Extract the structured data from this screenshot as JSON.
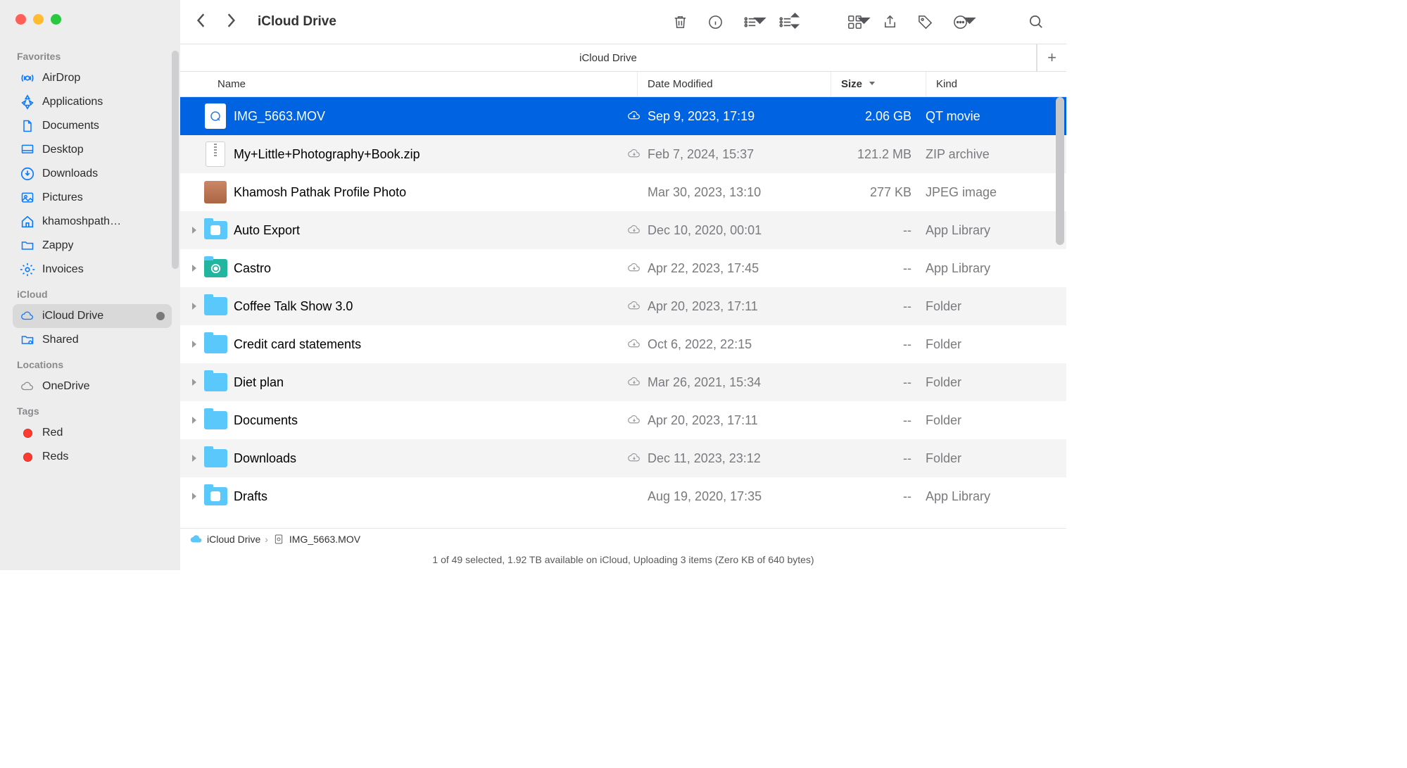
{
  "window": {
    "title": "iCloud Drive"
  },
  "sidebar": {
    "sections": [
      {
        "header": "Favorites",
        "items": [
          {
            "icon": "airdrop",
            "label": "AirDrop"
          },
          {
            "icon": "app",
            "label": "Applications"
          },
          {
            "icon": "doc",
            "label": "Documents"
          },
          {
            "icon": "desktop",
            "label": "Desktop"
          },
          {
            "icon": "download",
            "label": "Downloads"
          },
          {
            "icon": "pictures",
            "label": "Pictures"
          },
          {
            "icon": "home",
            "label": "khamoshpath…"
          },
          {
            "icon": "folder",
            "label": "Zappy"
          },
          {
            "icon": "gear",
            "label": "Invoices"
          }
        ]
      },
      {
        "header": "iCloud",
        "items": [
          {
            "icon": "cloud",
            "label": "iCloud Drive",
            "selected": true,
            "status": true
          },
          {
            "icon": "shared",
            "label": "Shared"
          }
        ]
      },
      {
        "header": "Locations",
        "items": [
          {
            "icon": "cloud-gray",
            "label": "OneDrive"
          }
        ]
      },
      {
        "header": "Tags",
        "items": [
          {
            "icon": "tag-red",
            "label": "Red"
          },
          {
            "icon": "tag-red",
            "label": "Reds"
          }
        ]
      }
    ]
  },
  "tabs": {
    "active": "iCloud Drive"
  },
  "columns": {
    "name": "Name",
    "date": "Date Modified",
    "size": "Size",
    "kind": "Kind"
  },
  "files": [
    {
      "icon": "qt",
      "expandable": false,
      "name": "IMG_5663.MOV",
      "cloud": true,
      "date": "Sep 9, 2023, 17:19",
      "size": "2.06 GB",
      "kind": "QT movie",
      "selected": true
    },
    {
      "icon": "zip",
      "expandable": false,
      "name": "My+Little+Photography+Book.zip",
      "cloud": true,
      "date": "Feb 7, 2024, 15:37",
      "size": "121.2 MB",
      "kind": "ZIP archive"
    },
    {
      "icon": "jpg",
      "expandable": false,
      "name": "Khamosh Pathak Profile Photo",
      "cloud": false,
      "date": "Mar 30, 2023, 13:10",
      "size": "277 KB",
      "kind": "JPEG image"
    },
    {
      "icon": "appfolder",
      "expandable": true,
      "name": "Auto Export",
      "cloud": true,
      "date": "Dec 10, 2020, 00:01",
      "size": "--",
      "kind": "App Library"
    },
    {
      "icon": "castro",
      "expandable": true,
      "name": "Castro",
      "cloud": true,
      "date": "Apr 22, 2023, 17:45",
      "size": "--",
      "kind": "App Library"
    },
    {
      "icon": "folder",
      "expandable": true,
      "name": "Coffee Talk Show 3.0",
      "cloud": true,
      "date": "Apr 20, 2023, 17:11",
      "size": "--",
      "kind": "Folder"
    },
    {
      "icon": "folder",
      "expandable": true,
      "name": "Credit card statements",
      "cloud": true,
      "date": "Oct 6, 2022, 22:15",
      "size": "--",
      "kind": "Folder"
    },
    {
      "icon": "folder",
      "expandable": true,
      "name": "Diet plan",
      "cloud": true,
      "date": "Mar 26, 2021, 15:34",
      "size": "--",
      "kind": "Folder"
    },
    {
      "icon": "folder",
      "expandable": true,
      "name": "Documents",
      "cloud": true,
      "date": "Apr 20, 2023, 17:11",
      "size": "--",
      "kind": "Folder"
    },
    {
      "icon": "folder",
      "expandable": true,
      "name": "Downloads",
      "cloud": true,
      "date": "Dec 11, 2023, 23:12",
      "size": "--",
      "kind": "Folder"
    },
    {
      "icon": "appfolder",
      "expandable": true,
      "name": "Drafts",
      "cloud": false,
      "date": "Aug 19, 2020, 17:35",
      "size": "--",
      "kind": "App Library"
    }
  ],
  "path": {
    "root": "iCloud Drive",
    "file": "IMG_5663.MOV"
  },
  "status_text": "1 of 49 selected, 1.92 TB available on iCloud, Uploading 3 items (Zero KB of 640 bytes)"
}
